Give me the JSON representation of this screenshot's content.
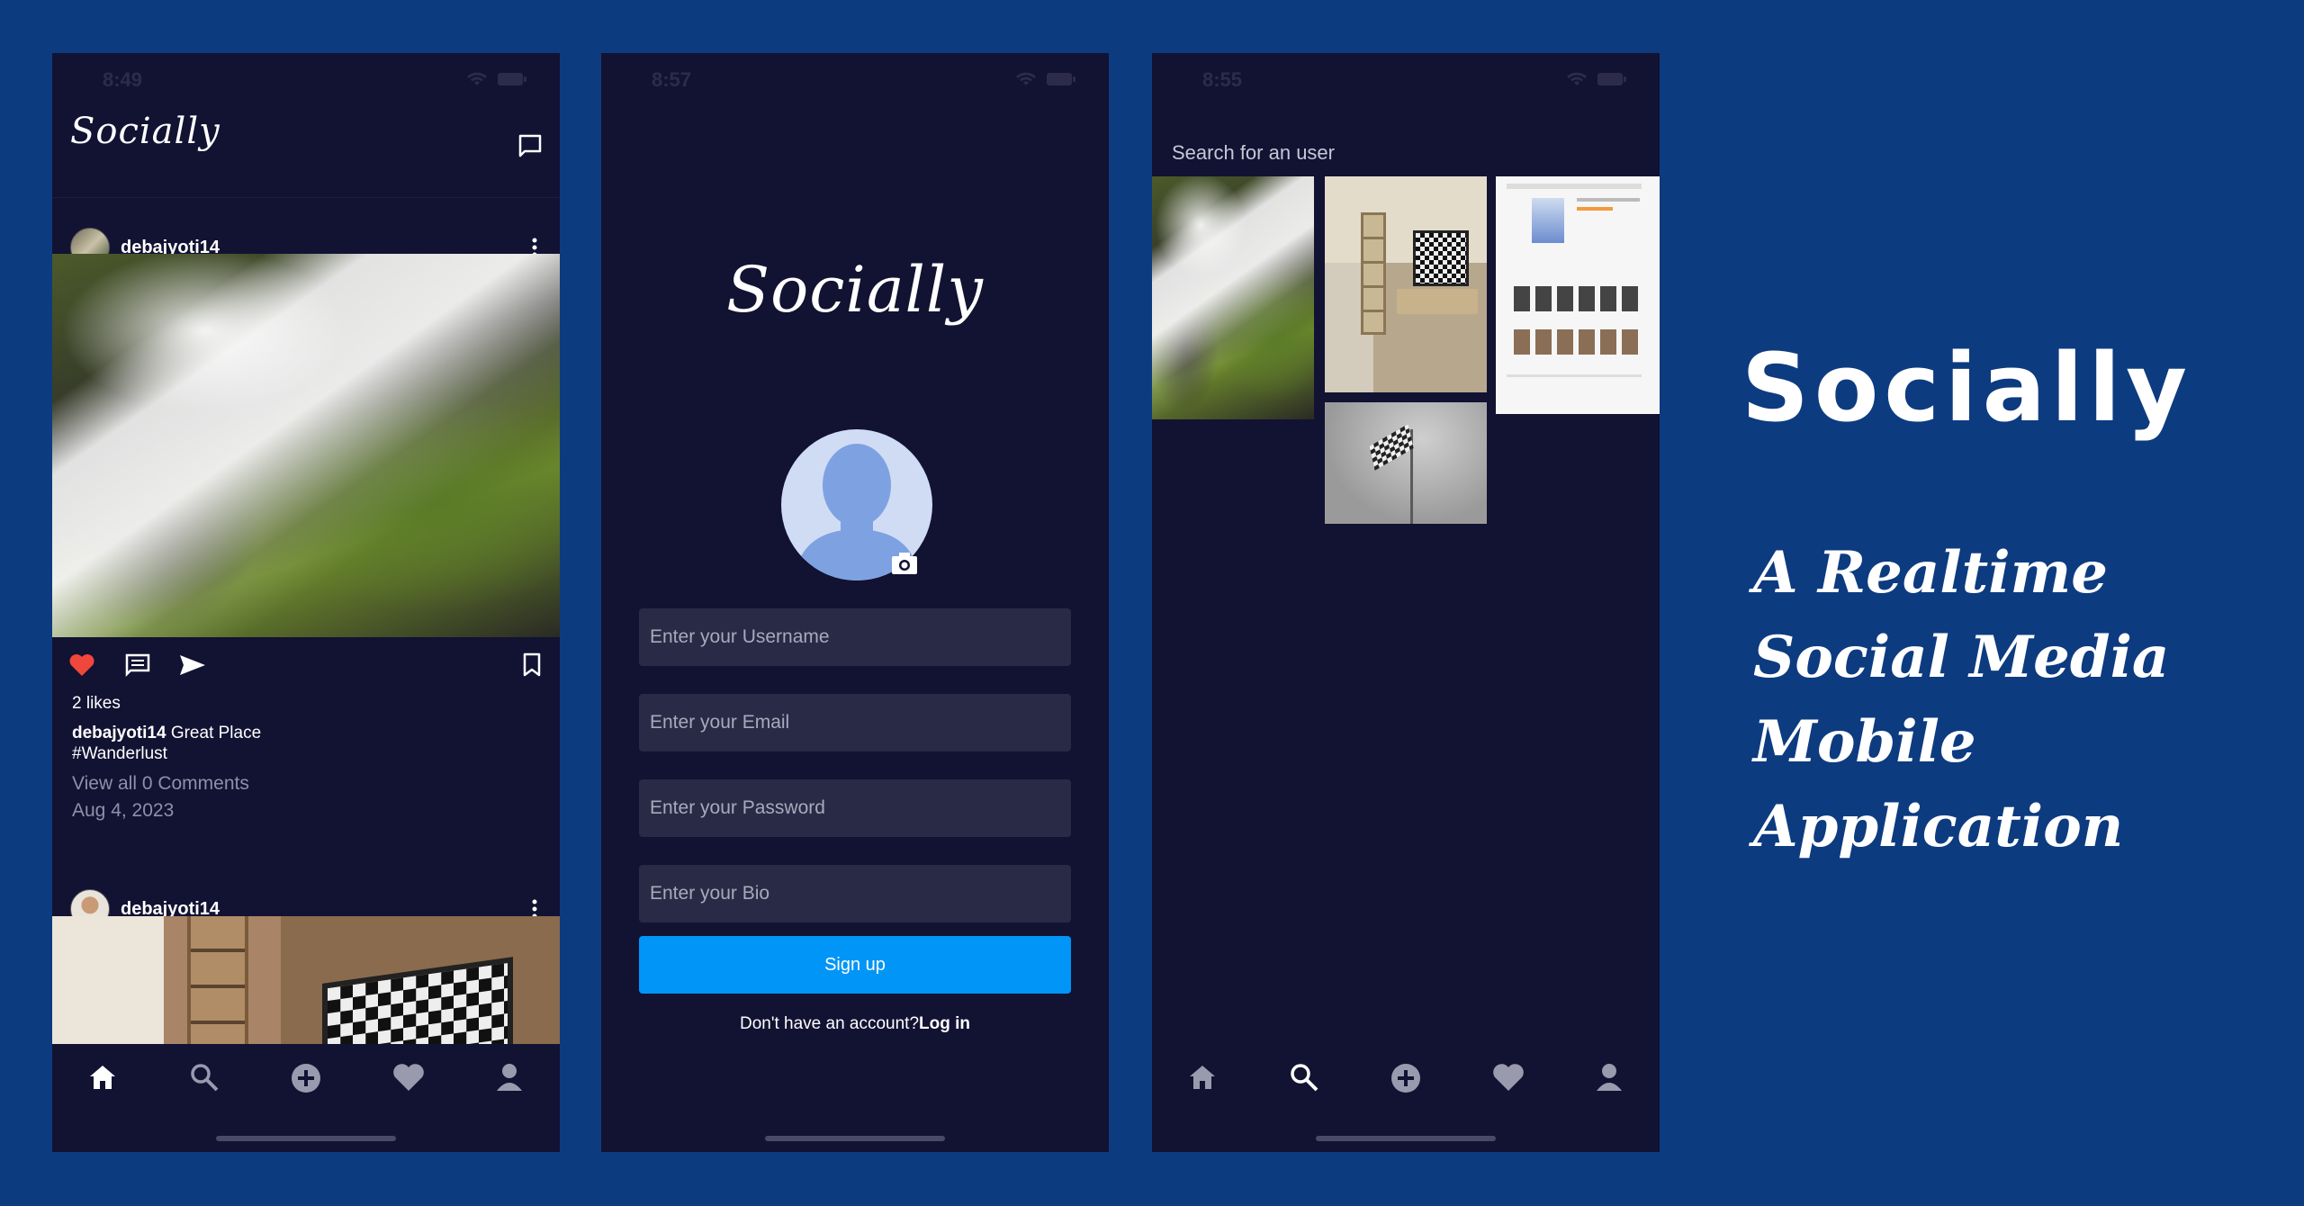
{
  "screen1": {
    "status_time": "8:49",
    "logo": "Socially",
    "posts": [
      {
        "username": "debajyoti14",
        "likes": "2 likes",
        "caption_user": "debajyoti14",
        "caption_text": "Great Place",
        "hashtag": "#Wanderlust",
        "comments": "View all 0 Comments",
        "date": "Aug 4, 2023"
      },
      {
        "username": "debajyoti14"
      }
    ],
    "like_color": "#f0473c"
  },
  "screen2": {
    "status_time": "8:57",
    "logo": "Socially",
    "fields": {
      "username_placeholder": "Enter your Username",
      "email_placeholder": "Enter your Email",
      "password_placeholder": "Enter your Password",
      "bio_placeholder": "Enter your Bio"
    },
    "signup_label": "Sign up",
    "account_prompt": "Don't have an account?",
    "login_label": "Log in",
    "button_color": "#0095f6"
  },
  "screen3": {
    "status_time": "8:55",
    "search_placeholder": "Search for an user"
  },
  "nav": [
    "home-icon",
    "search-icon",
    "add-circle-icon",
    "heart-icon",
    "profile-icon"
  ],
  "promo": {
    "title": "Socially",
    "tagline": "A Realtime Social Media Mobile Application"
  }
}
